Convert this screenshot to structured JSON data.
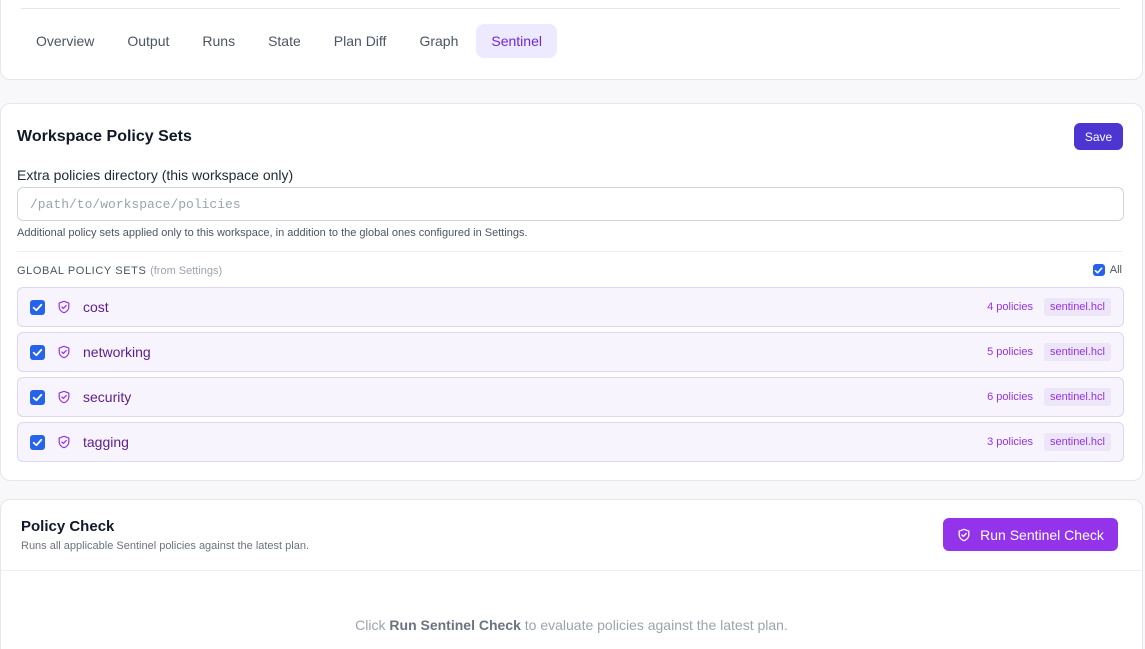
{
  "tabs": [
    {
      "label": "Overview",
      "active": false
    },
    {
      "label": "Output",
      "active": false
    },
    {
      "label": "Runs",
      "active": false
    },
    {
      "label": "State",
      "active": false
    },
    {
      "label": "Plan Diff",
      "active": false
    },
    {
      "label": "Graph",
      "active": false
    },
    {
      "label": "Sentinel",
      "active": true
    }
  ],
  "workspace_policy_sets": {
    "title": "Workspace Policy Sets",
    "save_label": "Save",
    "dir_label": "Extra policies directory (this workspace only)",
    "dir_value": "",
    "dir_placeholder": "/path/to/workspace/policies",
    "dir_help": "Additional policy sets applied only to this workspace, in addition to the global ones configured in Settings.",
    "global_heading": "GLOBAL POLICY SETS",
    "global_from": "(from Settings)",
    "all_label": "All",
    "all_checked": true,
    "sets": [
      {
        "name": "cost",
        "count": "4 policies",
        "file": "sentinel.hcl",
        "checked": true
      },
      {
        "name": "networking",
        "count": "5 policies",
        "file": "sentinel.hcl",
        "checked": true
      },
      {
        "name": "security",
        "count": "6 policies",
        "file": "sentinel.hcl",
        "checked": true
      },
      {
        "name": "tagging",
        "count": "3 policies",
        "file": "sentinel.hcl",
        "checked": true
      }
    ]
  },
  "policy_check": {
    "title": "Policy Check",
    "subtitle": "Runs all applicable Sentinel policies against the latest plan.",
    "run_label": "Run Sentinel Check",
    "empty_prefix": "Click ",
    "empty_emphasis": "Run Sentinel Check",
    "empty_suffix": " to evaluate policies against the latest plan."
  },
  "colors": {
    "accent": "#9333ea",
    "save": "#4c35d0",
    "checkbox": "#2563eb",
    "active_tab_bg": "#ede9fe"
  },
  "icons": {
    "policy_set": "shield-check-icon",
    "run_button": "shield-check-icon",
    "checkbox": "check-icon"
  }
}
